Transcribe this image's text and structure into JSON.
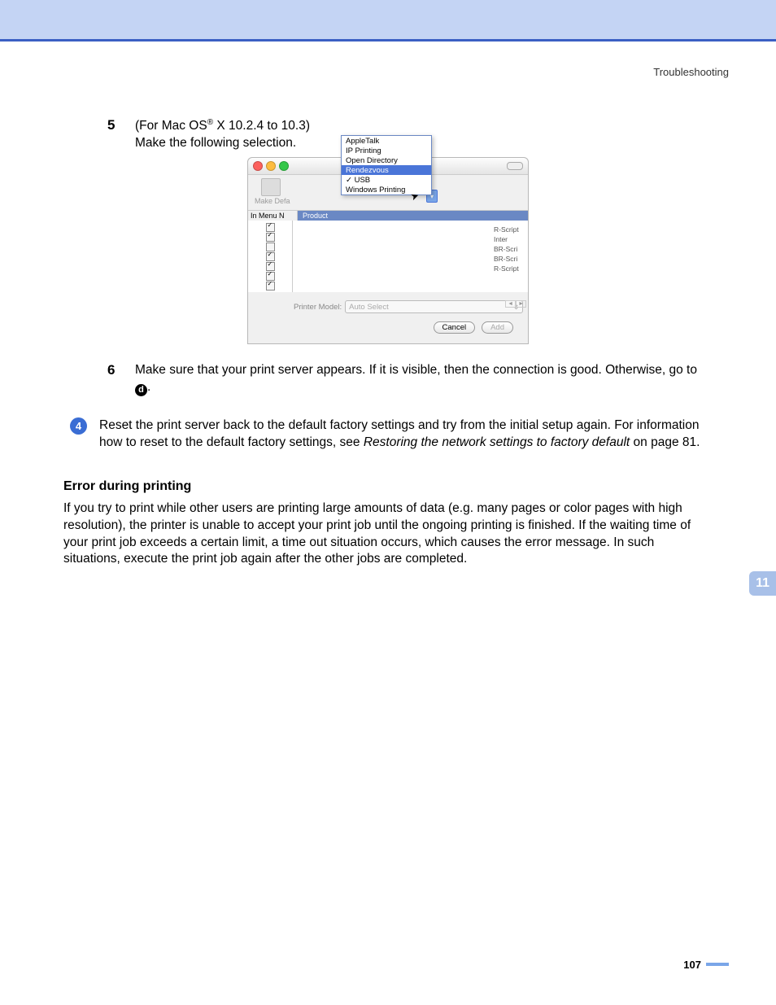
{
  "header": {
    "section": "Troubleshooting"
  },
  "steps": {
    "s5": {
      "num": "5",
      "line1a": "(For Mac OS",
      "line1b": " X 10.2.4 to 10.3)",
      "line2": "Make the following selection."
    },
    "s6": {
      "num": "6",
      "body_a": "Make sure that your print server appears. If it is visible, then the connection is good. Otherwise, go to ",
      "body_b": "."
    },
    "ref4": "4",
    "refd": "d"
  },
  "screenshot": {
    "menu": {
      "items": [
        "AppleTalk",
        "IP Printing",
        "Open Directory",
        "Rendezvous",
        "USB",
        "Windows Printing"
      ],
      "selected": "Rendezvous",
      "checked": "USB"
    },
    "toolbar_label": "Make Defa",
    "cols": {
      "menu": "In Menu   N",
      "product": "Product"
    },
    "right_hints": [
      "R-Script",
      "",
      "Inter",
      "BR-Scri",
      "BR-Scri",
      "R-Script"
    ],
    "printer_model_label": "Printer Model:",
    "printer_model_value": "Auto Select",
    "buttons": {
      "cancel": "Cancel",
      "add": "Add"
    }
  },
  "step4": {
    "num": "4",
    "body_a": "Reset the print server back to the default factory settings and try from the initial setup again. For information how to reset to the default factory settings, see ",
    "body_link": "Restoring the network settings to factory default",
    "body_b": " on page 81."
  },
  "error_section": {
    "title": "Error during printing",
    "para": "If you try to print while other users are printing large amounts of data (e.g. many pages or color pages with high resolution), the printer is unable to accept your print job until the ongoing printing is finished. If the waiting time of your print job exceeds a certain limit, a time out situation occurs, which causes the error message. In such situations, execute the print job again after the other jobs are completed."
  },
  "page": {
    "tab": "11",
    "number": "107"
  },
  "chart_data": {
    "type": "table",
    "note": "no chart present"
  }
}
